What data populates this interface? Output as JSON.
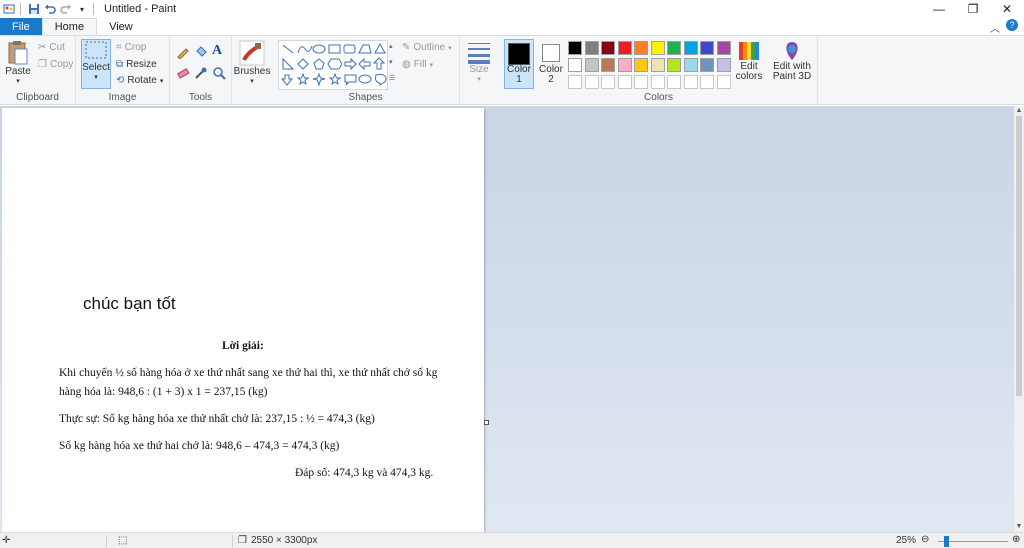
{
  "window": {
    "title": "Untitled - Paint",
    "controls": [
      "minimize-icon",
      "restore-icon",
      "close-icon"
    ]
  },
  "quick_access": [
    "paint-app-icon",
    "save-icon",
    "undo-icon",
    "redo-icon",
    "customize-dropdown-icon"
  ],
  "tabs": [
    {
      "label": "File"
    },
    {
      "label": "Home"
    },
    {
      "label": "View"
    }
  ],
  "ribbon": {
    "clipboard": {
      "label": "Clipboard",
      "paste": "Paste",
      "cut": "Cut",
      "copy": "Copy"
    },
    "image": {
      "label": "Image",
      "select": "Select",
      "crop": "Crop",
      "resize": "Resize",
      "rotate": "Rotate"
    },
    "tools": {
      "label": "Tools"
    },
    "brushes": {
      "label": "Brushes"
    },
    "shapes": {
      "label": "Shapes",
      "outline": "Outline",
      "fill": "Fill"
    },
    "size": {
      "label": "Size"
    },
    "colors": {
      "label": "Colors",
      "color1": "Color 1",
      "color2": "Color 2",
      "edit_colors": "Edit colors",
      "edit_paint3d": "Edit with Paint 3D",
      "palette_row1": [
        "#000000",
        "#7f7f7f",
        "#880015",
        "#ed1c24",
        "#ff7f27",
        "#fff200",
        "#22b14c",
        "#00a2e8",
        "#3f48cc",
        "#a349a4"
      ],
      "palette_row2": [
        "#ffffff",
        "#c3c3c3",
        "#b97a57",
        "#ffaec9",
        "#ffc90e",
        "#efe4b0",
        "#b5e61d",
        "#99d9ea",
        "#7092be",
        "#c8bfe7"
      ],
      "color1_value": "#000000",
      "color2_value": "#ffffff"
    }
  },
  "canvas": {
    "handwriting": "chúc bạn tốt",
    "heading": "Lời giải:",
    "line1": "Khi chuyển ½ số hàng hóa ở xe thứ nhất sang xe thứ hai thì, xe thứ nhất chở số kg",
    "line2": "hàng hóa là: 948,6 : (1 + 3) x 1 = 237,15 (kg)",
    "line3": "Thực sự: Số kg hàng hóa xe thứ nhất chở là: 237,15 : ½ = 474,3 (kg)",
    "line4": "Số kg hàng hóa xe thứ hai chở là: 948,6 – 474,3 = 474,3 (kg)",
    "line5": "Đáp số: 474,3 kg và 474,3 kg."
  },
  "status": {
    "dimensions": "2550 × 3300px",
    "zoom": "25%"
  }
}
